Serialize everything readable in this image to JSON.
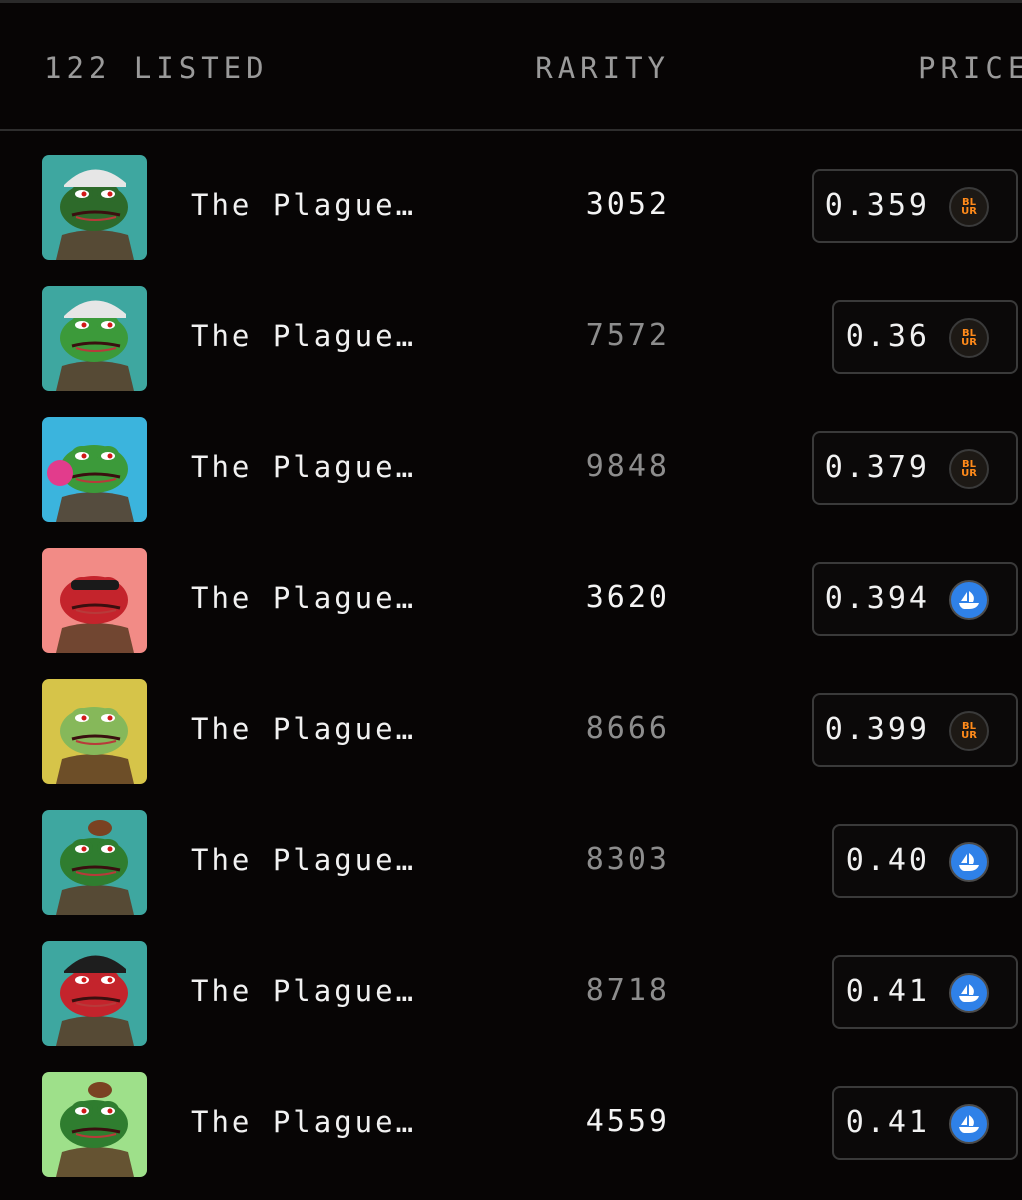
{
  "header": {
    "listed_label": "122 LISTED",
    "rarity_label": "RARITY",
    "price_label": "PRICE"
  },
  "colors": {
    "background": "#070505",
    "blur_orange": "#ff8a1a",
    "opensea_blue": "#2f81e8"
  },
  "items": [
    {
      "name": "The Plague…",
      "rarity": "3052",
      "rarity_style": "bright",
      "price": "0.359",
      "marketplace": "blur",
      "marketplace_icon": "blur-icon",
      "marketplace_text": [
        "BL",
        "UR"
      ],
      "bg": "#3ea7a0",
      "skin": "#2d6a2a",
      "accessory": "cap-white"
    },
    {
      "name": "The Plague…",
      "rarity": "7572",
      "rarity_style": "dim",
      "price": "0.36",
      "marketplace": "blur",
      "marketplace_icon": "blur-icon",
      "marketplace_text": [
        "BL",
        "UR"
      ],
      "bg": "#3ea7a0",
      "skin": "#3c9a3a",
      "accessory": "cap-white"
    },
    {
      "name": "The Plague…",
      "rarity": "9848",
      "rarity_style": "dim",
      "price": "0.379",
      "marketplace": "blur",
      "marketplace_icon": "blur-icon",
      "marketplace_text": [
        "BL",
        "UR"
      ],
      "bg": "#3bb4dd",
      "skin": "#3c9a3a",
      "accessory": "bubble"
    },
    {
      "name": "The Plague…",
      "rarity": "3620",
      "rarity_style": "bright",
      "price": "0.394",
      "marketplace": "opensea",
      "marketplace_icon": "opensea-icon",
      "marketplace_text": [],
      "bg": "#f28b86",
      "skin": "#c4242c",
      "accessory": "shades"
    },
    {
      "name": "The Plague…",
      "rarity": "8666",
      "rarity_style": "dim",
      "price": "0.399",
      "marketplace": "blur",
      "marketplace_icon": "blur-icon",
      "marketplace_text": [
        "BL",
        "UR"
      ],
      "bg": "#d6c449",
      "skin": "#86b85a",
      "accessory": "none"
    },
    {
      "name": "The Plague…",
      "rarity": "8303",
      "rarity_style": "dim",
      "price": "0.40",
      "marketplace": "opensea",
      "marketplace_icon": "opensea-icon",
      "marketplace_text": [],
      "bg": "#3ea7a0",
      "skin": "#2f7d2f",
      "accessory": "bun"
    },
    {
      "name": "The Plague…",
      "rarity": "8718",
      "rarity_style": "dim",
      "price": "0.41",
      "marketplace": "opensea",
      "marketplace_icon": "opensea-icon",
      "marketplace_text": [],
      "bg": "#3ea7a0",
      "skin": "#c4242c",
      "accessory": "cap-black"
    },
    {
      "name": "The Plague…",
      "rarity": "4559",
      "rarity_style": "bright",
      "price": "0.41",
      "marketplace": "opensea",
      "marketplace_icon": "opensea-icon",
      "marketplace_text": [],
      "bg": "#9ee08a",
      "skin": "#2f7d2f",
      "accessory": "bun"
    }
  ]
}
